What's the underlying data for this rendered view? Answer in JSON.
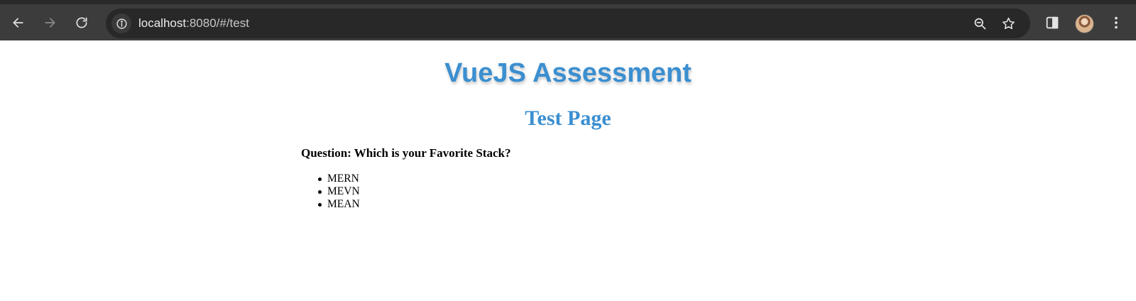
{
  "browser": {
    "url_host": "localhost",
    "url_rest": ":8080/#/test"
  },
  "page": {
    "title": "VueJS Assessment",
    "subtitle": "Test Page",
    "question": "Question: Which is your Favorite Stack?",
    "options": [
      "MERN",
      "MEVN",
      "MEAN"
    ]
  },
  "colors": {
    "heading": "#3b8fd0",
    "toolbar": "#3c3c3c",
    "omnibox": "#282828"
  }
}
